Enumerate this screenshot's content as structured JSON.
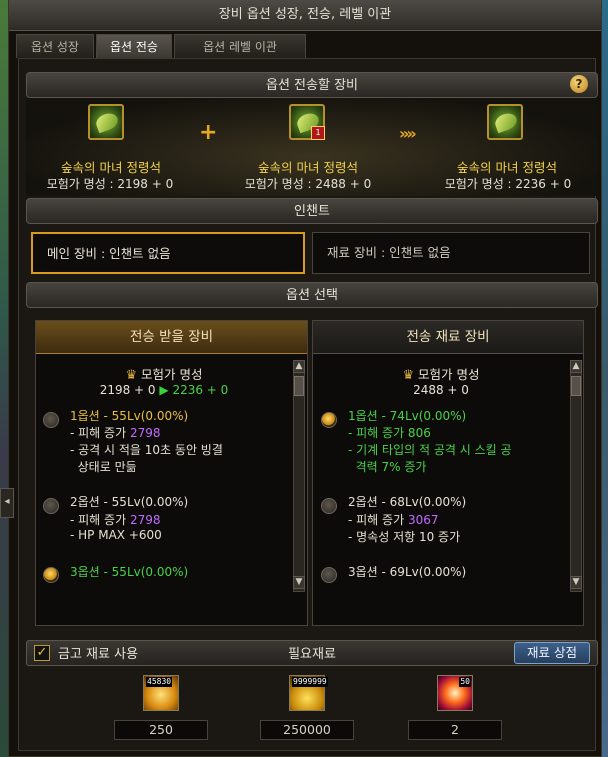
{
  "window": {
    "title": "장비 옵션 성장, 전승, 레벨 이관"
  },
  "tabs": [
    {
      "label": "옵션 성장",
      "active": false
    },
    {
      "label": "옵션 전승",
      "active": true
    },
    {
      "label": "옵션 레벨 이관",
      "active": false
    }
  ],
  "transfer": {
    "header": "옵션 전송할 장비",
    "help_icon": "?",
    "plus_sign": "+",
    "arrow_sign": "»»",
    "items": [
      {
        "name": "숲속의 마녀 정령석",
        "fame": "모험가 명성 : 2198 + 0",
        "icon": "forest-witch-spirit-stone-icon"
      },
      {
        "name": "숲속의 마녀 정령석",
        "fame": "모험가 명성 : 2488 + 0",
        "icon": "forest-witch-spirit-stone-icon",
        "badge": "1"
      },
      {
        "name": "숲속의 마녀 정령석",
        "fame": "모험가 명성 : 2236 + 0",
        "icon": "forest-witch-spirit-stone-icon"
      }
    ]
  },
  "enchant": {
    "header": "인챈트",
    "main": "메인 장비 : 인챈트 없음",
    "material": "재료 장비 : 인챈트 없음"
  },
  "options": {
    "header": "옵션 선택",
    "left": {
      "title": "전승 받을 장비",
      "fame_label": "모험가 명성",
      "fame_from": "2198 + 0",
      "fame_arrow": "▶",
      "fame_to": "2236 + 0",
      "rows": [
        {
          "title": "1옵션 - 55Lv(0.00%)",
          "selected": false,
          "lines": [
            [
              "- 피해 증가 ",
              "2798"
            ],
            [
              "- 공격 시 적을 10초 동안 빙결",
              ""
            ],
            [
              "  상태로 만듦",
              ""
            ]
          ]
        },
        {
          "title": "2옵션 - 55Lv(0.00%)",
          "selected": false,
          "lines": [
            [
              "- 피해 증가 ",
              "2798"
            ],
            [
              "- HP MAX +600",
              ""
            ]
          ]
        },
        {
          "title": "3옵션 - 55Lv(0.00%)",
          "selected": true,
          "lines": []
        }
      ]
    },
    "right": {
      "title": "전송 재료 장비",
      "fame_label": "모험가 명성",
      "fame_value": "2488 + 0",
      "rows": [
        {
          "title": "1옵션 - 74Lv(0.00%)",
          "selected": true,
          "lines": [
            [
              "- 피해 증가 806",
              ""
            ],
            [
              "- 기계 타입의 적 공격 시 스킬 공",
              ""
            ],
            [
              "  격력 7% 증가",
              ""
            ]
          ]
        },
        {
          "title": "2옵션 - 68Lv(0.00%)",
          "selected": false,
          "lines": [
            [
              "- 피해 증가 ",
              "3067"
            ],
            [
              "- 명속성 저항 10 증가",
              ""
            ]
          ]
        },
        {
          "title": "3옵션 - 69Lv(0.00%)",
          "selected": false,
          "lines": []
        }
      ]
    }
  },
  "bottom": {
    "checkbox_label": "금고 재료 사용",
    "checkbox_checked": true,
    "required_label": "필요재료",
    "shop_button": "재료 상점"
  },
  "materials": [
    {
      "icon": "gold-crystal-icon",
      "stock": "45830",
      "qty": "250"
    },
    {
      "icon": "gold-coins-icon",
      "stock": "9999999",
      "qty": "250000"
    },
    {
      "icon": "red-burst-orb-icon",
      "stock": "50",
      "qty": "2"
    }
  ],
  "colors": {
    "accent_gold": "#d89a1c",
    "option_green": "#4ad24a",
    "option_purple": "#c06cff",
    "shop_blue": "#3d5f8a"
  }
}
